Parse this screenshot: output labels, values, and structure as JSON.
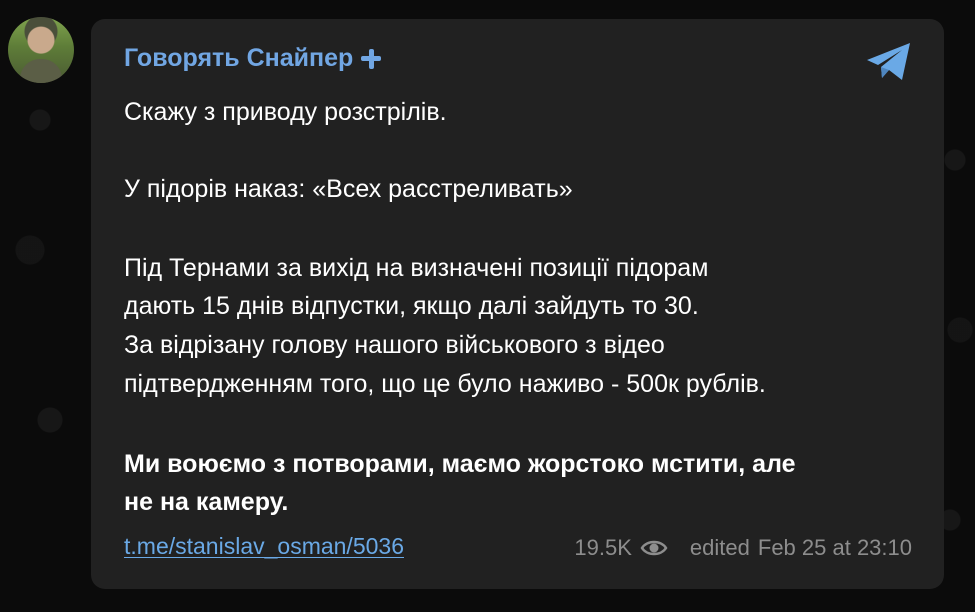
{
  "channel": {
    "name": "Говорять Снайпер",
    "badge_icon": "cross-icon",
    "share_icon": "telegram-share-icon",
    "accent_color": "#71a6e3"
  },
  "message": {
    "line1": "Скажу з приводу розстрілів.",
    "line2": "У підорів наказ: «Всех расстреливать»",
    "line3": "Під Тернами за вихід на визначені позиції підорам",
    "line4": "дають 15 днів відпустки, якщо далі зайдуть то 30.",
    "line5": "За відрізану голову нашого військового з відео",
    "line6": "підтвердженням того, що це було наживо - 500к рублів.",
    "line7": "Ми воюємо з потворами, маємо жорстоко мстити, але",
    "line8": "не на камеру."
  },
  "footer": {
    "link": "t.me/stanislav_osman/5036",
    "views": "19.5K",
    "edited_label": "edited",
    "date": "Feb 25 at 23:10"
  }
}
